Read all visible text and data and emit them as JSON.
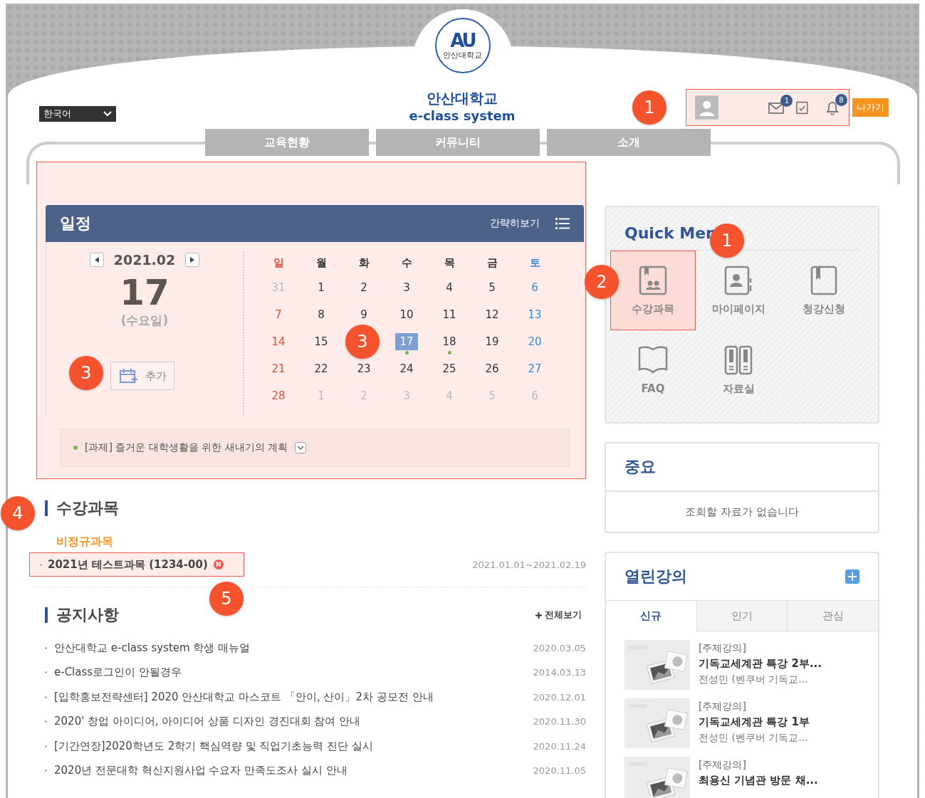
{
  "header": {
    "language": "한국어",
    "logo": {
      "mark": "AU",
      "name": "안산대학교"
    },
    "site_name": "안산대학교",
    "site_subtitle": "e-class system",
    "user": {
      "highlighted": true,
      "callout": "1",
      "messages_badge": "1",
      "notifications_badge": "8"
    },
    "exit_button": "나가기"
  },
  "nav": [
    {
      "label": "교육현황"
    },
    {
      "label": "커뮤니티"
    },
    {
      "label": "소개"
    }
  ],
  "schedule": {
    "highlighted": true,
    "title": "일정",
    "view_toggle": "간략히보기",
    "month": "2021.02",
    "day": "17",
    "weekday": "(수요일)",
    "add_button": "추가",
    "add_callout": "3",
    "weekdays": [
      {
        "label": "일",
        "kind": "sun"
      },
      {
        "label": "월",
        "kind": "day"
      },
      {
        "label": "화",
        "kind": "day"
      },
      {
        "label": "수",
        "kind": "day"
      },
      {
        "label": "목",
        "kind": "day"
      },
      {
        "label": "금",
        "kind": "day"
      },
      {
        "label": "토",
        "kind": "sat"
      }
    ],
    "weeks": [
      [
        {
          "kind": "sun",
          "day": "31",
          "other_month": true
        },
        {
          "kind": "day",
          "day": "1"
        },
        {
          "kind": "day",
          "day": "2"
        },
        {
          "kind": "day",
          "day": "3"
        },
        {
          "kind": "day",
          "day": "4"
        },
        {
          "kind": "day",
          "day": "5"
        },
        {
          "kind": "sat",
          "day": "6"
        }
      ],
      [
        {
          "kind": "sun",
          "day": "7"
        },
        {
          "kind": "day",
          "day": "8"
        },
        {
          "kind": "day",
          "day": "9"
        },
        {
          "kind": "day",
          "day": "10"
        },
        {
          "kind": "day",
          "day": "11"
        },
        {
          "kind": "day",
          "day": "12"
        },
        {
          "kind": "sat",
          "day": "13"
        }
      ],
      [
        {
          "kind": "sun",
          "day": "14"
        },
        {
          "kind": "day",
          "day": "15"
        },
        {
          "kind": "callout",
          "number": "3"
        },
        {
          "kind": "day",
          "day": "17",
          "selected": true,
          "event": true
        },
        {
          "kind": "day",
          "day": "18",
          "event": true
        },
        {
          "kind": "day",
          "day": "19"
        },
        {
          "kind": "sat",
          "day": "20"
        }
      ],
      [
        {
          "kind": "sun",
          "day": "21"
        },
        {
          "kind": "day",
          "day": "22"
        },
        {
          "kind": "day",
          "day": "23"
        },
        {
          "kind": "day",
          "day": "24"
        },
        {
          "kind": "day",
          "day": "25"
        },
        {
          "kind": "day",
          "day": "26"
        },
        {
          "kind": "sat",
          "day": "27"
        }
      ],
      [
        {
          "kind": "sun",
          "day": "28"
        },
        {
          "kind": "day",
          "day": "1",
          "other_month": true
        },
        {
          "kind": "day",
          "day": "2",
          "other_month": true
        },
        {
          "kind": "day",
          "day": "3",
          "other_month": true
        },
        {
          "kind": "day",
          "day": "4",
          "other_month": true
        },
        {
          "kind": "day",
          "day": "5",
          "other_month": true
        },
        {
          "kind": "sat",
          "day": "6",
          "other_month": true
        }
      ]
    ],
    "events": [
      {
        "text": "[과제] 즐거운 대학생활을 위한 새내기의 계획",
        "color": "#7ab648"
      }
    ]
  },
  "courses": {
    "title": "수강과목",
    "callout": "4",
    "group": "비정규과목",
    "items": [
      {
        "name": "2021년 테스트과목 (1234-00)",
        "new_badge": "N",
        "period": "2021.01.01~2021.02.19",
        "highlighted": true,
        "callout": "5"
      }
    ]
  },
  "notices": {
    "title": "공지사항",
    "more": "전체보기",
    "rows": [
      {
        "title": "안산대학교 e-class system 학생 매뉴얼",
        "date": "2020.03.05"
      },
      {
        "title": "e-Class로그인이 안될경우",
        "date": "2014.03.13"
      },
      {
        "title": "[입학홍보전략센터] 2020 안산대학교 마스코트 「안이, 산이」2차 공모전 안내",
        "date": "2020.12.01"
      },
      {
        "title": "2020' 창업 아이디어, 아이디어 상품 디자인 경진대회 참여 안내",
        "date": "2020.11.30"
      },
      {
        "title": "[기간연장]2020학년도 2학기 핵심역량 및 직업기초능력 진단 실시",
        "date": "2020.11.24"
      },
      {
        "title": "2020년 전문대학 혁신지원사업 수요자 만족도조사 실시 안내",
        "date": "2020.11.05"
      }
    ]
  },
  "quick_menu": {
    "title": "Quick Men",
    "items": [
      {
        "label": "수강과목",
        "kind": "course",
        "highlighted": true,
        "callout": "2"
      },
      {
        "label": "마이페이지",
        "kind": "mypage",
        "highlighted": false,
        "callout": "1"
      },
      {
        "label": "청강신청",
        "kind": "book",
        "highlighted": false
      },
      {
        "label": "FAQ",
        "kind": "faq",
        "highlighted": false
      },
      {
        "label": "자료실",
        "kind": "archive",
        "highlighted": false
      }
    ]
  },
  "important": {
    "title": "중요",
    "empty_message": "조회할 자료가 없습니다"
  },
  "open_lectures": {
    "title": "열린강의",
    "tabs": [
      {
        "label": "신규",
        "selected": true
      },
      {
        "label": "인기",
        "selected": false
      },
      {
        "label": "관심",
        "selected": false
      }
    ],
    "items": [
      {
        "category": "[주제강의]",
        "title": "기독교세계관 특강 2부...",
        "instructor": "전성민 (벤쿠버 기독교..."
      },
      {
        "category": "[주제강의]",
        "title": "기독교세계관 특강 1부",
        "instructor": "전성민 (벤쿠버 기독교..."
      },
      {
        "category": "[주제강의]",
        "title": "최용신 기념관 방문 채..."
      }
    ]
  }
}
